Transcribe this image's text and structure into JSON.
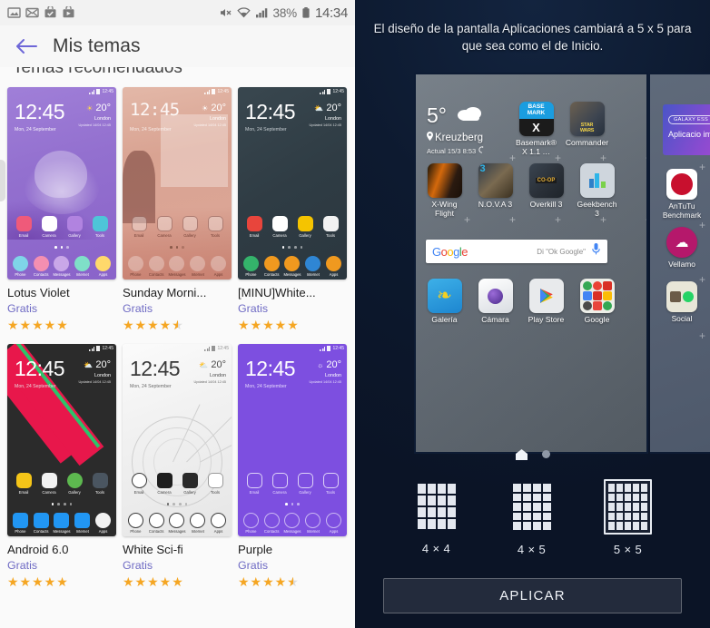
{
  "left_panel": {
    "status_bar": {
      "icons": [
        "image-icon",
        "mail-icon",
        "package-check-icon",
        "play-store-icon"
      ],
      "mute_icon": "volume-mute-icon",
      "wifi_icon": "wifi-icon",
      "signal_icon": "cellular-signal-icon",
      "battery_text": "38%",
      "battery_icon": "battery-icon",
      "time": "14:34"
    },
    "app_bar": {
      "back_icon": "back-arrow-icon",
      "title": "Mis temas"
    },
    "section_title": "Temas recomendados",
    "themes": [
      {
        "name": "Lotus Violet",
        "price": "Gratis",
        "rating": 5,
        "clock": "12:45",
        "date": "Mon, 24 September",
        "temp": "20°",
        "city": "London",
        "updated": "Updated 14/04 12:45",
        "apps": [
          "Email",
          "Camera",
          "Gallery",
          "Tools"
        ],
        "dock": [
          "Phone",
          "Contacts",
          "Messages",
          "Internet",
          "Apps"
        ]
      },
      {
        "name": "Sunday Morni...",
        "price": "Gratis",
        "rating": 4.5,
        "clock": "12:45",
        "date": "Mon, 24 September",
        "temp": "20°",
        "city": "London",
        "updated": "Updated 14/04 12:45",
        "apps": [
          "Email",
          "Camera",
          "Gallery",
          "Tools"
        ],
        "dock": [
          "Phone",
          "Contacts",
          "Messages",
          "Internet",
          "Apps"
        ]
      },
      {
        "name": "[MINU]White...",
        "price": "Gratis",
        "rating": 5,
        "clock": "12:45",
        "date": "Mon, 24 September",
        "temp": "20°",
        "city": "London",
        "updated": "Updated 14/04 12:45",
        "apps": [
          "Email",
          "Camera",
          "Gallery",
          "Tools"
        ],
        "dock": [
          "Phone",
          "Contacts",
          "Messages",
          "Internet",
          "Apps"
        ]
      },
      {
        "name": "Android 6.0",
        "price": "Gratis",
        "rating": 5,
        "clock": "12:45",
        "date": "Mon, 24 September",
        "temp": "20°",
        "city": "London",
        "updated": "Updated 14/04 12:45",
        "apps": [
          "Email",
          "Camera",
          "Gallery",
          "Tools"
        ],
        "dock": [
          "Phone",
          "Contacts",
          "Messages",
          "Internet",
          "Apps"
        ]
      },
      {
        "name": "White Sci-fi",
        "price": "Gratis",
        "rating": 5,
        "clock": "12:45",
        "date": "Mon, 24 September",
        "temp": "20°",
        "city": "London",
        "updated": "Updated 14/04 12:45",
        "apps": [
          "Email",
          "Camera",
          "Gallery",
          "Tools"
        ],
        "dock": [
          "Phone",
          "Contacts",
          "Messages",
          "Internet",
          "Apps"
        ]
      },
      {
        "name": "Purple",
        "price": "Gratis",
        "rating": 4.5,
        "clock": "12:45",
        "date": "Mon, 24 September",
        "temp": "20°",
        "city": "London",
        "updated": "Updated 14/04 12:45",
        "apps": [
          "Email",
          "Camera",
          "Gallery",
          "Tools"
        ],
        "dock": [
          "Phone",
          "Contacts",
          "Messages",
          "Internet",
          "Apps"
        ]
      }
    ]
  },
  "right_panel": {
    "message": "El diseño de la pantalla Aplicaciones cambiará a 5 x 5 para que sea como el de Inicio.",
    "preview": {
      "weather": {
        "temp": "5°",
        "icon": "cloud-icon",
        "location": "Kreuzberg",
        "location_pin_icon": "location-pin-icon",
        "updated": "Actual 15/3 8:53",
        "refresh_icon": "refresh-icon"
      },
      "apps_row1": [
        {
          "label": "Basemark® X 1.1 …",
          "icon": "basemark-x-icon"
        },
        {
          "label": "Commander",
          "icon": "star-wars-commander-icon"
        }
      ],
      "apps_row2": [
        {
          "label": "X-Wing Flight",
          "icon": "x-wing-flight-icon"
        },
        {
          "label": "N.O.V.A 3",
          "icon": "nova-3-icon"
        },
        {
          "label": "Overkill 3",
          "icon": "overkill-3-icon"
        },
        {
          "label": "Geekbench 3",
          "icon": "geekbench-3-icon"
        }
      ],
      "search": {
        "logo": "Google",
        "hint": "Di \"Ok Google\"",
        "mic_icon": "microphone-icon"
      },
      "apps_row3": [
        {
          "label": "Galería",
          "icon": "gallery-icon"
        },
        {
          "label": "Cámara",
          "icon": "camera-icon"
        },
        {
          "label": "Play Store",
          "icon": "play-store-icon"
        },
        {
          "label": "Google",
          "icon": "google-folder-icon"
        }
      ]
    },
    "peek_page": {
      "banner_tag": "GALAXY ESS",
      "banner_title": "Aplicacio imprescin",
      "apps": [
        {
          "label": "AnTuTu Benchmark",
          "icon": "antutu-benchmark-icon"
        },
        {
          "label": "Vellamo",
          "icon": "vellamo-icon"
        },
        {
          "label": "Social",
          "icon": "social-folder-icon"
        }
      ]
    },
    "pager": {
      "home_icon": "home-page-icon",
      "dot_icon": "page-dot-icon"
    },
    "grid_options": [
      {
        "label": "4 × 4",
        "cols": 4,
        "rows": 4,
        "selected": false
      },
      {
        "label": "4 × 5",
        "cols": 4,
        "rows": 5,
        "selected": false
      },
      {
        "label": "5 × 5",
        "cols": 5,
        "rows": 5,
        "selected": true
      }
    ],
    "apply_button": "APLICAR"
  }
}
